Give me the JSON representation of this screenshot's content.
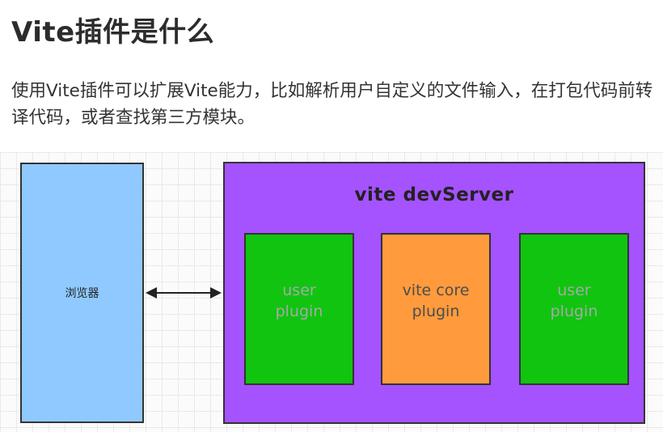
{
  "heading": "Vite插件是什么",
  "description": "使用Vite插件可以扩展Vite能力，比如解析用户自定义的文件输入，在打包代码前转译代码，或者查找第三方模块。",
  "diagram": {
    "browser_label": "浏览器",
    "server_title": "vite devServer",
    "plugins": [
      {
        "label": "user\nplugin",
        "color": "#10c410"
      },
      {
        "label": "vite core\nplugin",
        "color": "#ff9b3c"
      },
      {
        "label": "user\nplugin",
        "color": "#10c410"
      }
    ],
    "colors": {
      "browser": "#8fc9ff",
      "server": "#a552ff"
    }
  }
}
